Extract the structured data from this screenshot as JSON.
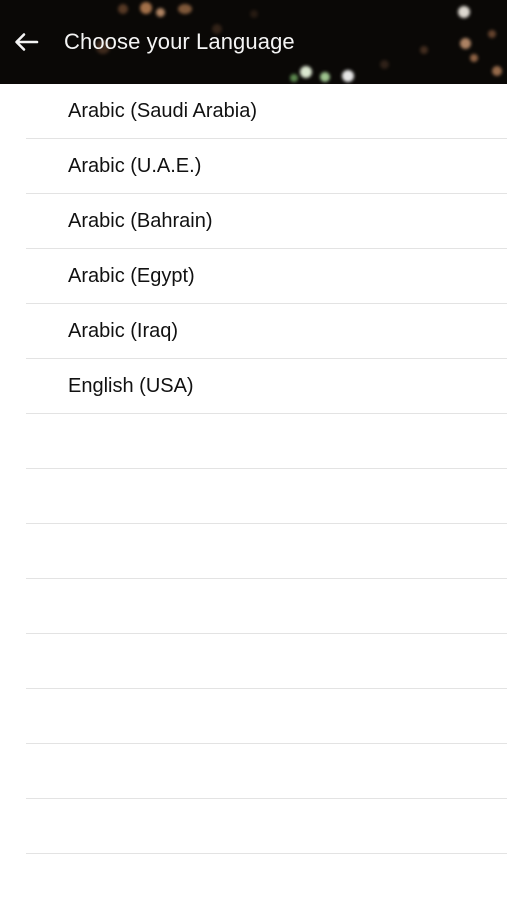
{
  "header": {
    "back_icon": "arrow-left-icon",
    "title": "Choose your Language"
  },
  "languages": [
    "Arabic (Saudi Arabia)",
    "Arabic (U.A.E.)",
    "Arabic (Bahrain)",
    "Arabic (Egypt)",
    "Arabic (Iraq)",
    "English (USA)"
  ],
  "colors": {
    "header_background": "#0a0806",
    "title_text": "#f4f4f4",
    "row_text": "#111111",
    "separator": "#e3e3e3"
  }
}
